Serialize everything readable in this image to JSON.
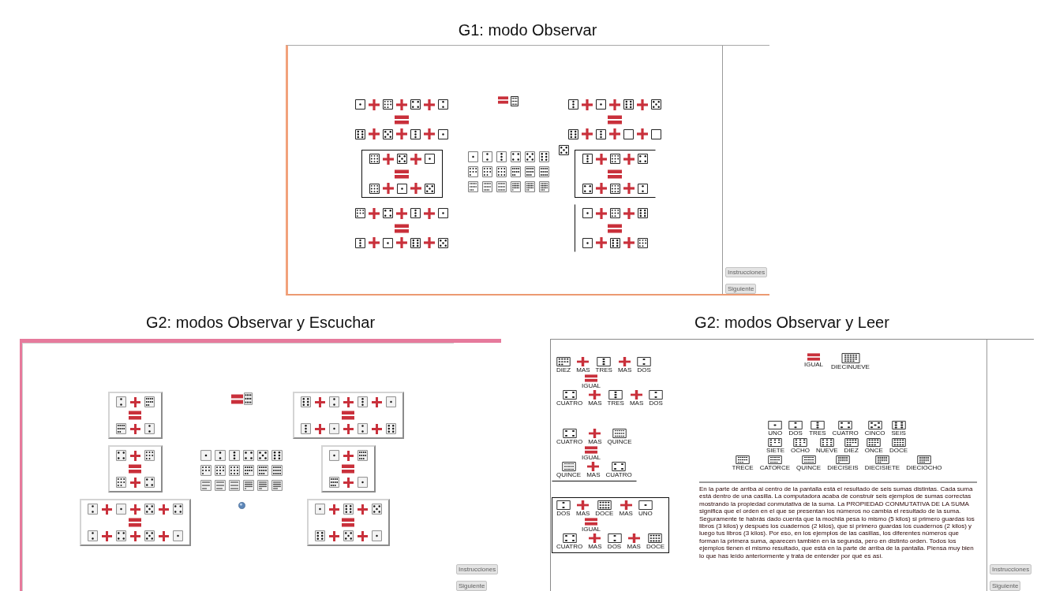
{
  "rows": [
    {
      "figures": [
        {
          "caption": "G1: modo Observar",
          "kind": "observe",
          "left_equations": [
            {
              "kind": "plain",
              "top": [
                {
                  "kind": "one"
                },
                {
                  "kind": "plus"
                },
                {
                  "kind": "eight"
                },
                {
                  "kind": "plus"
                },
                {
                  "kind": "four"
                },
                {
                  "kind": "plus"
                },
                {
                  "kind": "two"
                }
              ],
              "middle": [
                {
                  "kind": "equals"
                }
              ],
              "bottom": [
                {
                  "kind": "six"
                },
                {
                  "kind": "plus"
                },
                {
                  "kind": "five"
                },
                {
                  "kind": "plus"
                },
                {
                  "kind": "three"
                },
                {
                  "kind": "plus"
                },
                {
                  "kind": "one"
                }
              ]
            },
            {
              "kind": "boxed",
              "top": [
                {
                  "kind": "nine"
                },
                {
                  "kind": "plus"
                },
                {
                  "kind": "five"
                },
                {
                  "kind": "plus"
                },
                {
                  "kind": "one"
                }
              ],
              "middle": [
                {
                  "kind": "equals"
                }
              ],
              "bottom": [
                {
                  "kind": "nine"
                },
                {
                  "kind": "plus"
                },
                {
                  "kind": "one"
                },
                {
                  "kind": "plus"
                },
                {
                  "kind": "five"
                }
              ]
            },
            {
              "kind": "plain",
              "top": [
                {
                  "kind": "seven"
                },
                {
                  "kind": "plus"
                },
                {
                  "kind": "four"
                },
                {
                  "kind": "plus"
                },
                {
                  "kind": "three"
                },
                {
                  "kind": "plus"
                },
                {
                  "kind": "one"
                }
              ],
              "middle": [
                {
                  "kind": "equals"
                }
              ],
              "bottom": [
                {
                  "kind": "three"
                },
                {
                  "kind": "plus"
                },
                {
                  "kind": "one"
                },
                {
                  "kind": "plus"
                },
                {
                  "kind": "six"
                },
                {
                  "kind": "plus"
                },
                {
                  "kind": "five"
                }
              ]
            }
          ],
          "result": [
            {
              "kind": "equals"
            },
            {
              "kind": "fifteen"
            }
          ],
          "palette": [
            [
              {
                "kind": "one"
              },
              {
                "kind": "two"
              },
              {
                "kind": "three"
              },
              {
                "kind": "four"
              },
              {
                "kind": "five"
              },
              {
                "kind": "six"
              }
            ],
            [
              {
                "kind": "seven"
              },
              {
                "kind": "eight"
              },
              {
                "kind": "nine"
              },
              {
                "kind": "ten"
              },
              {
                "kind": "eleven"
              },
              {
                "kind": "twelve"
              }
            ],
            [
              {
                "kind": "thirteen"
              },
              {
                "kind": "fourteen"
              },
              {
                "kind": "fifteen"
              },
              {
                "kind": "sixteen"
              },
              {
                "kind": "seventeen"
              },
              {
                "kind": "eighteen"
              }
            ]
          ],
          "right_equations": [
            {
              "kind": "plain",
              "top": [
                {
                  "kind": "three"
                },
                {
                  "kind": "plus"
                },
                {
                  "kind": "one"
                },
                {
                  "kind": "plus"
                },
                {
                  "kind": "six"
                },
                {
                  "kind": "plus"
                },
                {
                  "kind": "five"
                }
              ],
              "middle": [
                {
                  "kind": "equals"
                }
              ],
              "bottom": [
                {
                  "kind": "six"
                },
                {
                  "kind": "plus"
                },
                {
                  "kind": "three"
                },
                {
                  "kind": "plus"
                },
                {
                  "kind": "blank"
                },
                {
                  "kind": "plus"
                },
                {
                  "kind": "blank"
                }
              ]
            },
            {
              "kind": "open",
              "dragged_die": {
                "kind": "five"
              },
              "top": [
                {
                  "kind": "three"
                },
                {
                  "kind": "plus"
                },
                {
                  "kind": "eight"
                },
                {
                  "kind": "plus"
                },
                {
                  "kind": "four"
                }
              ],
              "middle": [
                {
                  "kind": "equals"
                }
              ],
              "bottom": [
                {
                  "kind": "four"
                },
                {
                  "kind": "plus"
                },
                {
                  "kind": "nine"
                },
                {
                  "kind": "plus"
                },
                {
                  "kind": "two"
                }
              ]
            },
            {
              "kind": "sided",
              "top": [
                {
                  "kind": "one"
                },
                {
                  "kind": "plus"
                },
                {
                  "kind": "eight"
                },
                {
                  "kind": "plus"
                },
                {
                  "kind": "six"
                }
              ],
              "middle": [
                {
                  "kind": "equals"
                }
              ],
              "bottom": [
                {
                  "kind": "one"
                },
                {
                  "kind": "plus"
                },
                {
                  "kind": "six"
                },
                {
                  "kind": "plus"
                },
                {
                  "kind": "eight"
                }
              ]
            }
          ],
          "buttons": [
            {
              "label": "Instrucciones"
            },
            {
              "label": "Siguiente"
            }
          ]
        }
      ]
    },
    {
      "figures": [
        {
          "caption": "G2: modos Observar y Escuchar",
          "kind": "listen",
          "left_equations": [
            {
              "kind": "raised",
              "top": [
                {
                  "kind": "two"
                },
                {
                  "kind": "plus"
                },
                {
                  "kind": "ten"
                }
              ],
              "middle": [
                {
                  "kind": "equals"
                }
              ],
              "bottom": [
                {
                  "kind": "ten"
                },
                {
                  "kind": "plus"
                },
                {
                  "kind": "two"
                }
              ]
            },
            {
              "kind": "raised",
              "top": [
                {
                  "kind": "four"
                },
                {
                  "kind": "plus"
                },
                {
                  "kind": "eight"
                }
              ],
              "middle": [
                {
                  "kind": "equals"
                }
              ],
              "bottom": [
                {
                  "kind": "eight"
                },
                {
                  "kind": "plus"
                },
                {
                  "kind": "four"
                }
              ]
            },
            {
              "kind": "raised",
              "top": [
                {
                  "kind": "two"
                },
                {
                  "kind": "plus"
                },
                {
                  "kind": "one"
                },
                {
                  "kind": "plus"
                },
                {
                  "kind": "five"
                },
                {
                  "kind": "plus"
                },
                {
                  "kind": "four"
                }
              ],
              "middle": [
                {
                  "kind": "equals"
                }
              ],
              "bottom": [
                {
                  "kind": "two"
                },
                {
                  "kind": "plus"
                },
                {
                  "kind": "four"
                },
                {
                  "kind": "plus"
                },
                {
                  "kind": "five"
                },
                {
                  "kind": "plus"
                },
                {
                  "kind": "one"
                }
              ]
            }
          ],
          "result": [
            {
              "kind": "equals"
            },
            {
              "kind": "twelve"
            }
          ],
          "palette": [
            [
              {
                "kind": "one"
              },
              {
                "kind": "two"
              },
              {
                "kind": "three"
              },
              {
                "kind": "four"
              },
              {
                "kind": "five"
              },
              {
                "kind": "six"
              }
            ],
            [
              {
                "kind": "seven"
              },
              {
                "kind": "eight"
              },
              {
                "kind": "nine"
              },
              {
                "kind": "ten"
              },
              {
                "kind": "eleven"
              },
              {
                "kind": "twelve"
              }
            ],
            [
              {
                "kind": "thirteen"
              },
              {
                "kind": "fourteen"
              },
              {
                "kind": "fifteen"
              },
              {
                "kind": "sixteen"
              },
              {
                "kind": "seventeen"
              },
              {
                "kind": "eighteen"
              }
            ]
          ],
          "right_equations": [
            {
              "kind": "raised",
              "top": [
                {
                  "kind": "six"
                },
                {
                  "kind": "plus"
                },
                {
                  "kind": "two"
                },
                {
                  "kind": "plus"
                },
                {
                  "kind": "three"
                },
                {
                  "kind": "plus"
                },
                {
                  "kind": "one"
                }
              ],
              "middle": [
                {
                  "kind": "equals"
                }
              ],
              "bottom": [
                {
                  "kind": "three"
                },
                {
                  "kind": "plus"
                },
                {
                  "kind": "one"
                },
                {
                  "kind": "plus"
                },
                {
                  "kind": "two"
                },
                {
                  "kind": "plus"
                },
                {
                  "kind": "six"
                }
              ]
            },
            {
              "kind": "raised",
              "top": [
                {
                  "kind": "one"
                },
                {
                  "kind": "plus"
                },
                {
                  "kind": "eleven"
                }
              ],
              "middle": [
                {
                  "kind": "equals"
                }
              ],
              "bottom": [
                {
                  "kind": "eleven"
                },
                {
                  "kind": "plus"
                },
                {
                  "kind": "one"
                }
              ]
            },
            {
              "kind": "raised",
              "top": [
                {
                  "kind": "one"
                },
                {
                  "kind": "plus"
                },
                {
                  "kind": "six"
                },
                {
                  "kind": "plus"
                },
                {
                  "kind": "five"
                }
              ],
              "middle": [
                {
                  "kind": "equals"
                }
              ],
              "bottom": [
                {
                  "kind": "six"
                },
                {
                  "kind": "plus"
                },
                {
                  "kind": "five"
                },
                {
                  "kind": "plus"
                },
                {
                  "kind": "one"
                }
              ]
            }
          ],
          "buttons": [
            {
              "label": "Instrucciones"
            },
            {
              "label": "Siguiente"
            }
          ]
        },
        {
          "caption": "G2: modos Observar y Leer",
          "kind": "read",
          "left_equations": [
            {
              "kind": "plain",
              "top": [
                {
                  "kind": "ten",
                  "label": "DIEZ"
                },
                {
                  "kind": "plus",
                  "label": "MAS"
                },
                {
                  "kind": "three",
                  "label": "TRES"
                },
                {
                  "kind": "plus",
                  "label": "MAS"
                },
                {
                  "kind": "two",
                  "label": "DOS"
                }
              ],
              "middle": [
                {
                  "kind": "equals",
                  "label": "IGUAL"
                }
              ],
              "bottom": [
                {
                  "kind": "four",
                  "label": "CUATRO"
                },
                {
                  "kind": "plus",
                  "label": "MAS"
                },
                {
                  "kind": "three",
                  "label": "TRES"
                },
                {
                  "kind": "plus",
                  "label": "MAS"
                },
                {
                  "kind": "two",
                  "label": "DOS"
                }
              ]
            },
            {
              "kind": "underlined",
              "top": [
                {
                  "kind": "four",
                  "label": "CUATRO"
                },
                {
                  "kind": "plus",
                  "label": "MAS"
                },
                {
                  "kind": "fifteen",
                  "label": "QUINCE"
                }
              ],
              "middle": [
                {
                  "kind": "equals",
                  "label": "IGUAL"
                }
              ],
              "bottom": [
                {
                  "kind": "fifteen",
                  "label": "QUINCE"
                },
                {
                  "kind": "plus",
                  "label": "MAS"
                },
                {
                  "kind": "four",
                  "label": "CUATRO"
                }
              ]
            },
            {
              "kind": "boxed",
              "top": [
                {
                  "kind": "two",
                  "label": "DOS"
                },
                {
                  "kind": "plus",
                  "label": "MAS"
                },
                {
                  "kind": "twelve",
                  "label": "DOCE"
                },
                {
                  "kind": "plus",
                  "label": "MAS"
                },
                {
                  "kind": "one",
                  "label": "UNO"
                }
              ],
              "middle": [
                {
                  "kind": "equals",
                  "label": "IGUAL"
                }
              ],
              "bottom": [
                {
                  "kind": "four",
                  "label": "CUATRO"
                },
                {
                  "kind": "plus",
                  "label": "MAS"
                },
                {
                  "kind": "two",
                  "label": "DOS"
                },
                {
                  "kind": "plus",
                  "label": "MAS"
                },
                {
                  "kind": "twelve",
                  "label": "DOCE"
                }
              ]
            }
          ],
          "result": [
            {
              "kind": "equals",
              "label": "IGUAL"
            },
            {
              "kind": "nineteen",
              "label": "DIECINUEVE"
            }
          ],
          "palette": [
            [
              {
                "kind": "one",
                "label": "UNO"
              },
              {
                "kind": "two",
                "label": "DOS"
              },
              {
                "kind": "three",
                "label": "TRES"
              },
              {
                "kind": "four",
                "label": "CUATRO"
              },
              {
                "kind": "five",
                "label": "CINCO"
              },
              {
                "kind": "six",
                "label": "SEIS"
              }
            ],
            [
              {
                "kind": "seven",
                "label": "SIETE"
              },
              {
                "kind": "eight",
                "label": "OCHO"
              },
              {
                "kind": "nine",
                "label": "NUEVE"
              },
              {
                "kind": "ten",
                "label": "DIEZ"
              },
              {
                "kind": "eleven",
                "label": "ONCE"
              },
              {
                "kind": "twelve",
                "label": "DOCE"
              }
            ],
            [
              {
                "kind": "thirteen",
                "label": "TRECE"
              },
              {
                "kind": "fourteen",
                "label": "CATORCE"
              },
              {
                "kind": "fifteen",
                "label": "QUINCE"
              },
              {
                "kind": "sixteen",
                "label": "DIECISEIS"
              },
              {
                "kind": "seventeen",
                "label": "DIECISIETE"
              },
              {
                "kind": "eighteen",
                "label": "DIECIOCHO"
              }
            ]
          ],
          "paragraph": "En la parte de arriba al centro de la pantalla está el resultado de seis sumas distintas. Cada suma está dentro de una casilla. La computadora acaba de construir seis ejemplos de sumas correctas mostrando la propiedad conmutativa de la suma. La PROPIEDAD CONMUTATIVA DE LA SUMA significa que el orden en el que se presentan los números no cambia el resultado de la suma. Seguramente te habrás dado cuenta que la mochila pesa lo mismo (5 kilos) si primero guardas los libros (3 kilos) y después los cuadernos (2 kilos), que si primero guardas los cuadernos (2 kilos) y luego tus libros (3 kilos). Por eso, en los ejemplos de las casillas, los diferentes números que forman la primera suma, aparecen también en la segunda, pero en distinto orden. Todos los ejemplos tienen el mismo resultado, que está en la parte de arriba de la pantalla. Piensa muy bien lo que has leído anteriormente y trata de entender por qué es así.",
          "buttons": [
            {
              "label": "Instrucciones"
            },
            {
              "label": "Siguiente"
            }
          ]
        }
      ]
    }
  ]
}
